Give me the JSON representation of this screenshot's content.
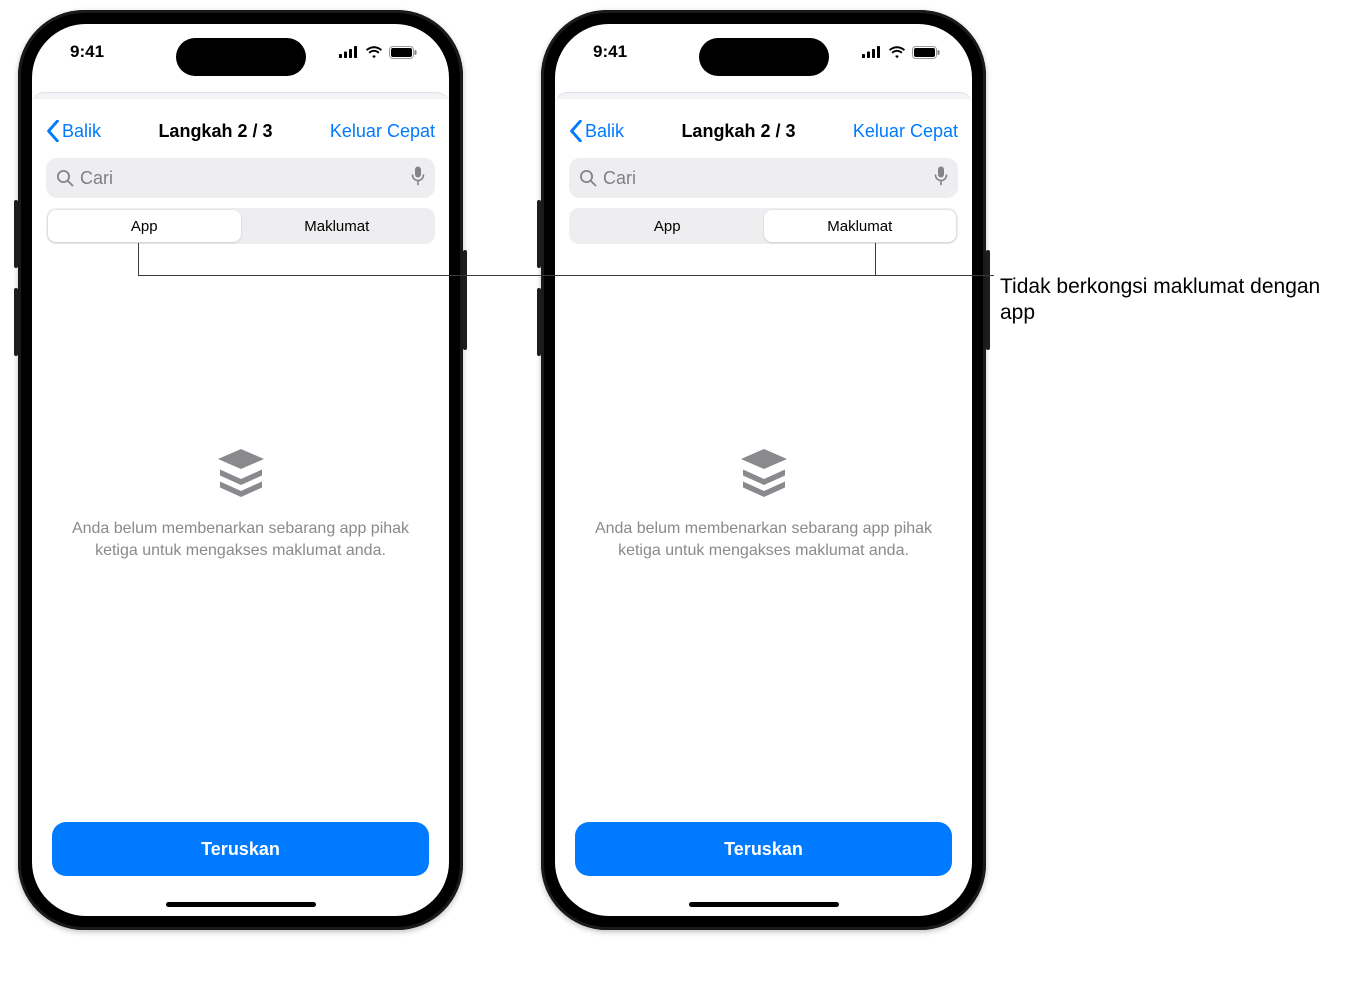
{
  "status": {
    "time": "9:41"
  },
  "nav": {
    "back": "Balik",
    "title": "Langkah 2 / 3",
    "action": "Keluar Cepat"
  },
  "search": {
    "placeholder": "Cari"
  },
  "tabs": {
    "app": "App",
    "info": "Maklumat"
  },
  "empty": {
    "message": "Anda belum membenarkan sebarang app pihak ketiga untuk mengakses maklumat anda."
  },
  "buttons": {
    "continue": "Teruskan"
  },
  "callout": {
    "text": "Tidak berkongsi maklumat dengan app"
  }
}
